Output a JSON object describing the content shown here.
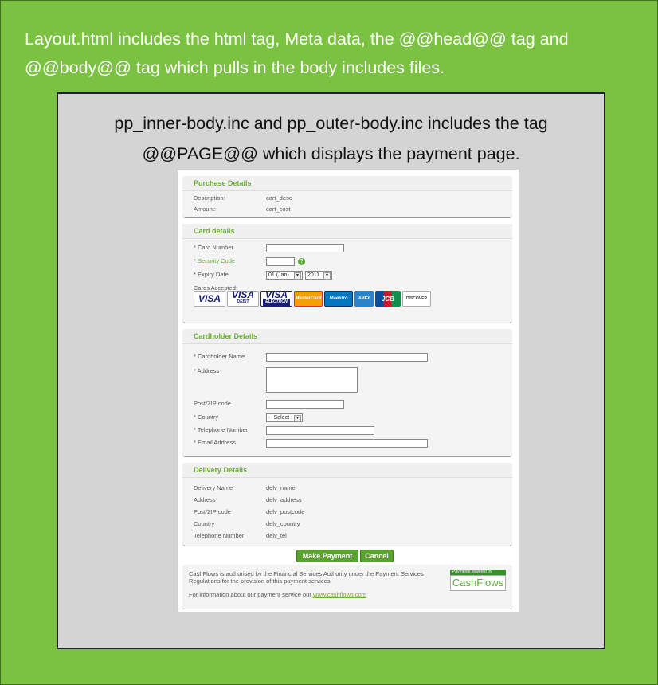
{
  "outer_text": "Layout.html includes the html tag, Meta data, the @@head@@ tag and @@body@@ tag which pulls in the body includes files.",
  "inner_text": "pp_inner-body.inc and pp_outer-body.inc includes the tag @@PAGE@@ which displays the payment page.",
  "purchase": {
    "title": "Purchase Details",
    "description_label": "Description:",
    "description_value": "cart_desc",
    "amount_label": "Amount:",
    "amount_value": "cart_cost"
  },
  "card": {
    "title": "Card details",
    "card_number_label": "* Card Number",
    "security_code_label": "* Security Code",
    "expiry_label": "* Expiry Date",
    "expiry_month": "01 (Jan)",
    "expiry_year": "2011",
    "cards_accepted_label": "Cards Accepted:",
    "logos": [
      "VISA",
      "VISA",
      "VISA",
      "MasterCard",
      "Maestro",
      "AMEX",
      "JCB",
      "DISCOVER"
    ],
    "visa_debit_sub": "DEBIT",
    "visa_electron_sub": "ELECTRON"
  },
  "cardholder": {
    "title": "Cardholder Details",
    "name_label": "* Cardholder Name",
    "address_label": "* Address",
    "postcode_label": "Post/ZIP code",
    "country_label": "* Country",
    "country_value": "-- Select --",
    "telephone_label": "* Telephone Number",
    "email_label": "* Email Address"
  },
  "delivery": {
    "title": "Delivery Details",
    "rows": [
      {
        "label": "Delivery Name",
        "value": "delv_name"
      },
      {
        "label": "Address",
        "value": "delv_address"
      },
      {
        "label": "Post/ZIP code",
        "value": "delv_postcode"
      },
      {
        "label": "Country",
        "value": "delv_country"
      },
      {
        "label": "Telephone Number",
        "value": "delv_tel"
      }
    ]
  },
  "buttons": {
    "make_payment": "Make Payment",
    "cancel": "Cancel"
  },
  "footer": {
    "line1": "CashFlows is authorised by the Financial Services Authority under the Payment Services Regulations for the provision of this payment services.",
    "line2": "For information about our payment service our",
    "link": "www.cashflows.com",
    "badge_top": "Payments powered by",
    "badge_brand": "CashFlows"
  },
  "colors": {
    "outer_bg": "#7cc242",
    "inner_bg": "#d4d4d4",
    "accent": "#6cab3a"
  }
}
